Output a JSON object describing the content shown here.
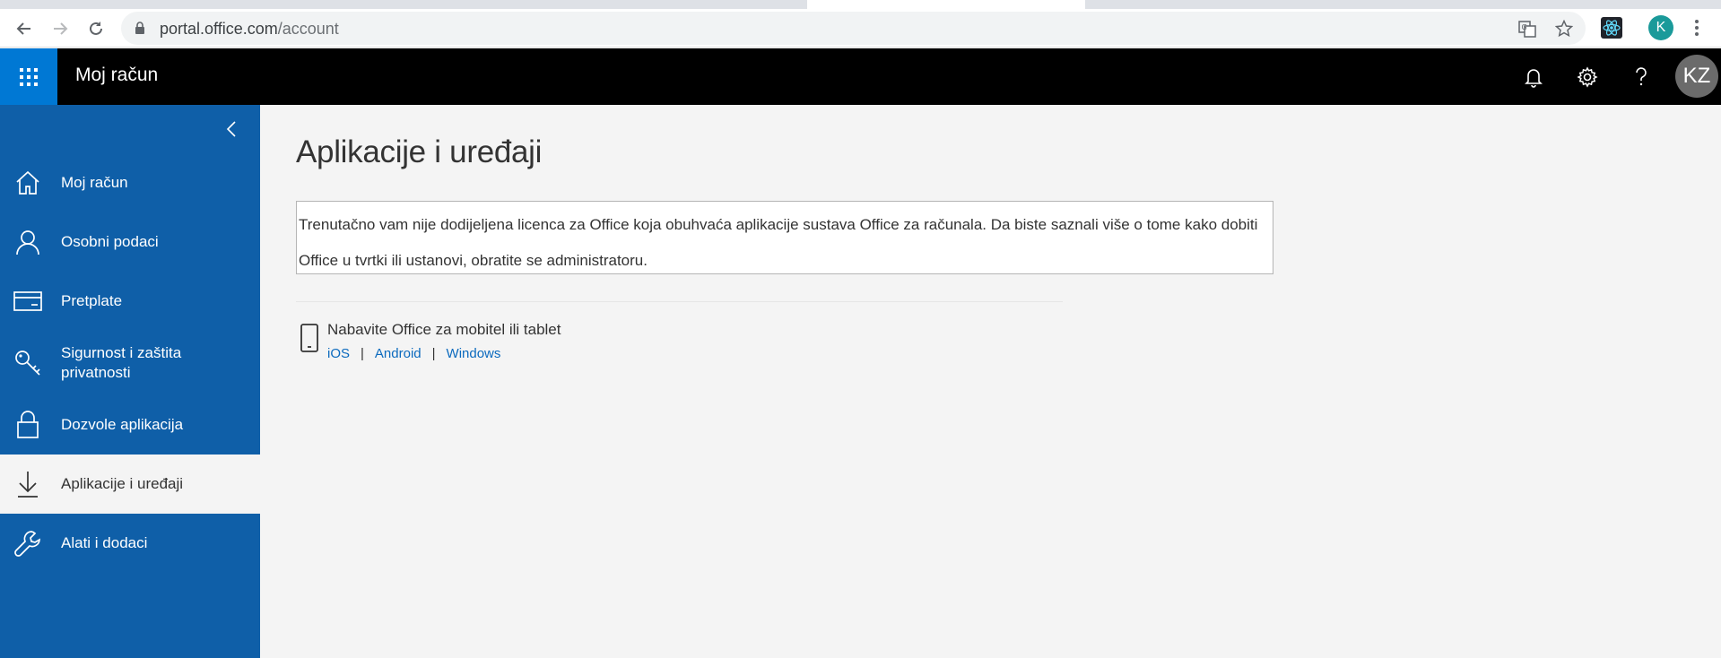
{
  "browser": {
    "url_host": "portal.office.com",
    "url_path": "/account",
    "profile_initial": "K"
  },
  "header": {
    "app_title": "Moj račun",
    "avatar_initials": "KZ"
  },
  "sidebar": {
    "items": [
      {
        "label": "Moj račun",
        "icon": "home-icon"
      },
      {
        "label": "Osobni podaci",
        "icon": "person-icon"
      },
      {
        "label": "Pretplate",
        "icon": "card-icon"
      },
      {
        "label": "Sigurnost i zaštita privatnosti",
        "icon": "key-icon"
      },
      {
        "label": "Dozvole aplikacija",
        "icon": "lock-icon"
      },
      {
        "label": "Aplikacije i uređaji",
        "icon": "download-icon",
        "active": true
      },
      {
        "label": "Alati i dodaci",
        "icon": "wrench-icon"
      }
    ]
  },
  "main": {
    "title": "Aplikacije i uređaji",
    "notice": "Trenutačno vam nije dodijeljena licenca za Office koja obuhvaća aplikacije sustava Office za računala. Da biste saznali više o tome kako dobiti Office u tvrtki ili ustanovi, obratite se administratoru.",
    "mobile": {
      "title": "Nabavite Office za mobitel ili tablet",
      "links": [
        "iOS",
        "Android",
        "Windows"
      ],
      "separator": "|"
    }
  },
  "colors": {
    "sidebar": "#0f5fa8",
    "waffle": "#0078d4",
    "link": "#0b6abe"
  }
}
